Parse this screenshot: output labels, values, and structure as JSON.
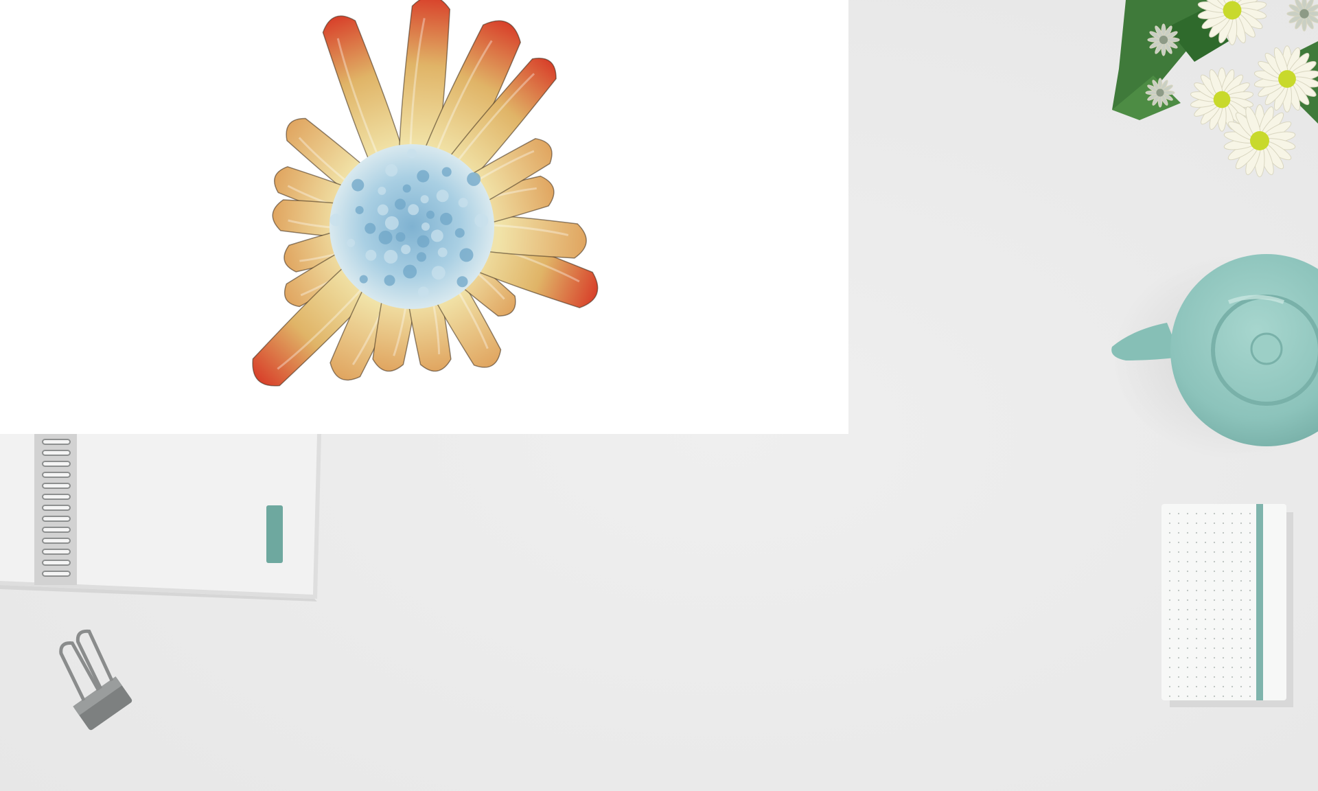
{
  "scene": {
    "background": "desk-surface",
    "palette": {
      "desk": "#ececec",
      "desk_shadow": "#e2e2e2",
      "panel": "#ffffff",
      "core_blue": "#a9cfe3",
      "cream": "#f1e3a8",
      "tan": "#e0b467",
      "orange": "#e98b3e",
      "red": "#d8402a",
      "teal": "#8cc3bb",
      "teal_dark": "#6ea89f",
      "leaf": "#3f7a3a",
      "petal": "#f7f5e6",
      "flower_center": "#c8d92c",
      "metal": "#8a8c8c"
    },
    "objects": [
      {
        "name": "volume-render-panel",
        "kind": "image-panel"
      },
      {
        "name": "splash-volume-render",
        "kind": "3d-visualization"
      },
      {
        "name": "flowers-bouquet",
        "kind": "photo-object"
      },
      {
        "name": "teapot",
        "kind": "photo-object"
      },
      {
        "name": "spiral-notebook",
        "kind": "photo-object"
      },
      {
        "name": "binder-clip",
        "kind": "photo-object"
      },
      {
        "name": "small-notebook",
        "kind": "photo-object"
      }
    ]
  }
}
